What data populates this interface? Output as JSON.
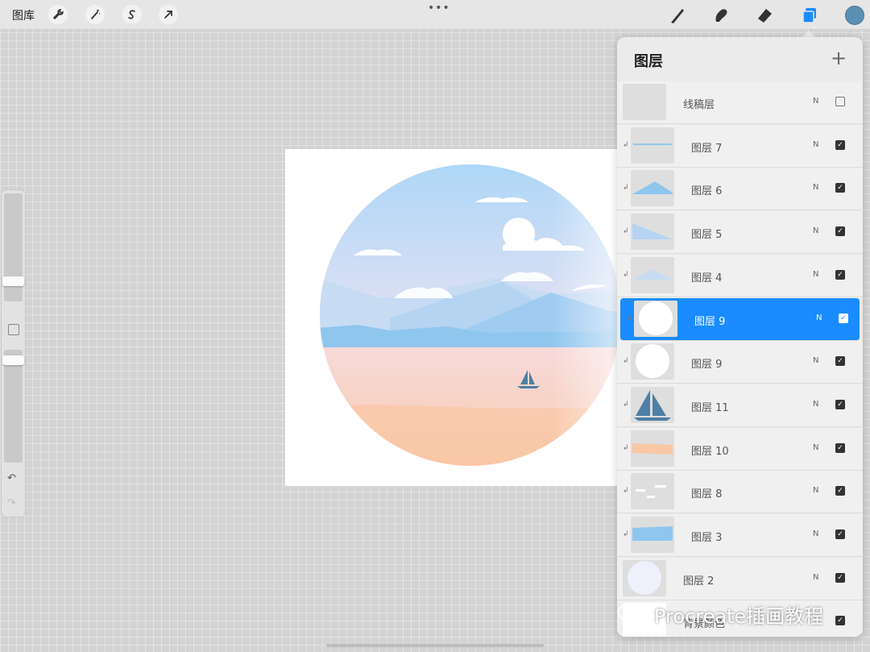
{
  "topbar": {
    "gallery_label": "图库",
    "dots": "•••",
    "color_swatch": "#5d8fb3",
    "left_tools": [
      "wrench-icon",
      "magic-wand-icon",
      "selection-s-icon",
      "transform-arrow-icon"
    ],
    "right_tools": [
      "brush-icon",
      "smudge-icon",
      "eraser-icon",
      "layers-icon"
    ]
  },
  "sidebar": {
    "undo_icon": "↶",
    "redo_icon": "↷"
  },
  "layers_panel": {
    "title": "图层",
    "add_icon": "+",
    "layers": [
      {
        "name": "线稿层",
        "blend": "N",
        "visible": false,
        "selected": false,
        "clipped": false,
        "thumb": "blank"
      },
      {
        "name": "图层 7",
        "blend": "N",
        "visible": true,
        "selected": false,
        "clipped": true,
        "thumb": "line"
      },
      {
        "name": "图层 6",
        "blend": "N",
        "visible": true,
        "selected": false,
        "clipped": true,
        "thumb": "mountain"
      },
      {
        "name": "图层 5",
        "blend": "N",
        "visible": true,
        "selected": false,
        "clipped": true,
        "thumb": "slope"
      },
      {
        "name": "图层 4",
        "blend": "N",
        "visible": true,
        "selected": false,
        "clipped": true,
        "thumb": "mountain-far"
      },
      {
        "name": "图层 9",
        "blend": "N",
        "visible": true,
        "selected": true,
        "clipped": true,
        "thumb": "circle"
      },
      {
        "name": "图层 9",
        "blend": "N",
        "visible": true,
        "selected": false,
        "clipped": true,
        "thumb": "circle"
      },
      {
        "name": "图层 11",
        "blend": "N",
        "visible": true,
        "selected": false,
        "clipped": true,
        "thumb": "boat"
      },
      {
        "name": "图层 10",
        "blend": "N",
        "visible": true,
        "selected": false,
        "clipped": true,
        "thumb": "sand"
      },
      {
        "name": "图层 8",
        "blend": "N",
        "visible": true,
        "selected": false,
        "clipped": true,
        "thumb": "clouds"
      },
      {
        "name": "图层 3",
        "blend": "N",
        "visible": true,
        "selected": false,
        "clipped": true,
        "thumb": "sea"
      },
      {
        "name": "图层 2",
        "blend": "N",
        "visible": true,
        "selected": false,
        "clipped": false,
        "thumb": "base-circle"
      },
      {
        "name": "背景颜色",
        "blend": "",
        "visible": true,
        "selected": false,
        "clipped": false,
        "thumb": "white"
      }
    ]
  },
  "watermark": {
    "text": "Procreate插画教程",
    "icon": "wechat-icon"
  },
  "colors": {
    "selected": "#1a8cff",
    "sky_top": "#a9d6f7",
    "sea": "#8fc6ee",
    "sand": "#f9c9a8",
    "boat": "#4e7fa6"
  }
}
